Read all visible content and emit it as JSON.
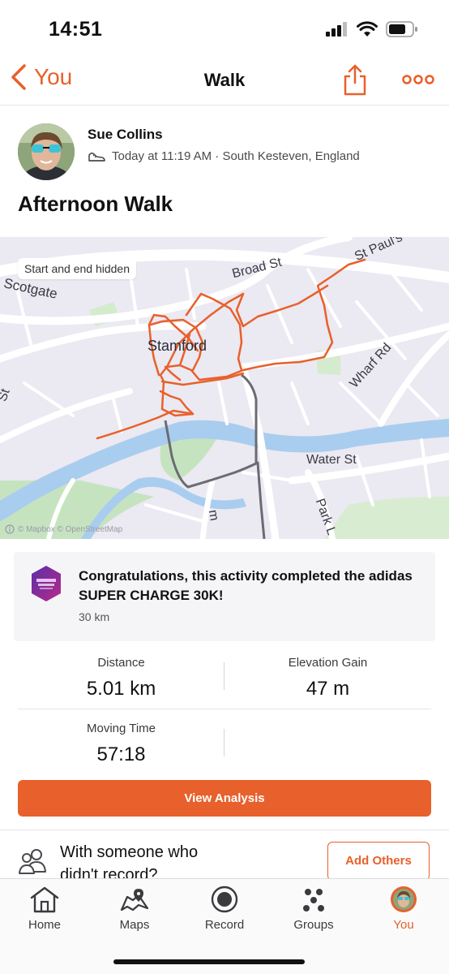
{
  "status": {
    "time": "14:51"
  },
  "nav": {
    "back_label": "You",
    "title": "Walk"
  },
  "activity": {
    "athlete": "Sue Collins",
    "meta": "Today at 11:19 AM · South Kesteven, England",
    "title": "Afternoon Walk"
  },
  "map": {
    "privacy_chip": "Start and end hidden",
    "attribution": "© Mapbox © OpenStreetMap",
    "labels": {
      "scotgate": "Scotgate",
      "broad_st": "Broad St",
      "st_pauls": "St Paul's",
      "stamford": "Stamford",
      "wharf_rd": "Wharf Rd",
      "water_st": "Water St",
      "park_l": "Park L",
      "st": "St",
      "m": "m"
    },
    "colors": {
      "route": "#e8602b",
      "hidden_route": "#6b6b73",
      "water": "#a9cdef",
      "park": "#c6e3c0"
    }
  },
  "achievement": {
    "text": "Congratulations, this activity completed the adidas SUPER CHARGE 30K!",
    "sub": "30 km"
  },
  "stats": {
    "distance_label": "Distance",
    "distance_value": "5.01 km",
    "elevation_label": "Elevation Gain",
    "elevation_value": "47 m",
    "moving_time_label": "Moving Time",
    "moving_time_value": "57:18"
  },
  "actions": {
    "view_analysis": "View Analysis",
    "with_someone": "With someone who didn't record?",
    "add_others": "Add Others"
  },
  "tabs": [
    {
      "label": "Home",
      "icon": "home-icon"
    },
    {
      "label": "Maps",
      "icon": "maps-icon"
    },
    {
      "label": "Record",
      "icon": "record-icon"
    },
    {
      "label": "Groups",
      "icon": "groups-icon"
    },
    {
      "label": "You",
      "icon": "avatar-icon"
    }
  ],
  "theme": {
    "accent": "#e8602b"
  }
}
